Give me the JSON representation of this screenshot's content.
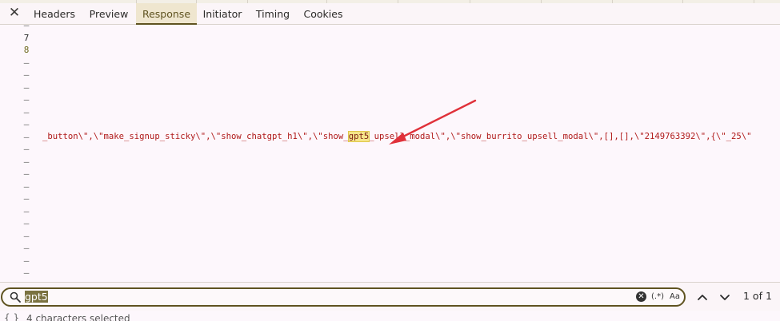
{
  "tabs": {
    "close": "✕",
    "items": [
      {
        "label": "Headers"
      },
      {
        "label": "Preview"
      },
      {
        "label": "Response"
      },
      {
        "label": "Initiator"
      },
      {
        "label": "Timing"
      },
      {
        "label": "Cookies"
      }
    ],
    "active": "Response"
  },
  "editor": {
    "line_numbers": [
      "–",
      "7",
      "8",
      "–",
      "–",
      "–",
      "–",
      "–",
      "–",
      "–",
      "–",
      "–",
      "–",
      "–",
      "–",
      "–",
      "–",
      "–",
      "–",
      "–",
      "–"
    ],
    "code_before": "_button\\\",\\\"make_signup_sticky\\\",\\\"show_chatgpt_h1\\\",\\\"show_",
    "code_match": "gpt5",
    "code_after": "_upsell_modal\\\",\\\"show_burrito_upsell_modal\\\",[],[],\\\"2149763392\\\",{\\\"_25\\\""
  },
  "search": {
    "value": "gpt5",
    "regex_label": "(.*)",
    "case_label": "Aa",
    "match_count": "1 of 1"
  },
  "status": {
    "icon": "{ }",
    "text": "4 characters selected"
  },
  "colors": {
    "accent": "#5f5320",
    "string": "#b01a1a",
    "highlight": "#f5e58a",
    "annotation_arrow": "#e0313a"
  }
}
